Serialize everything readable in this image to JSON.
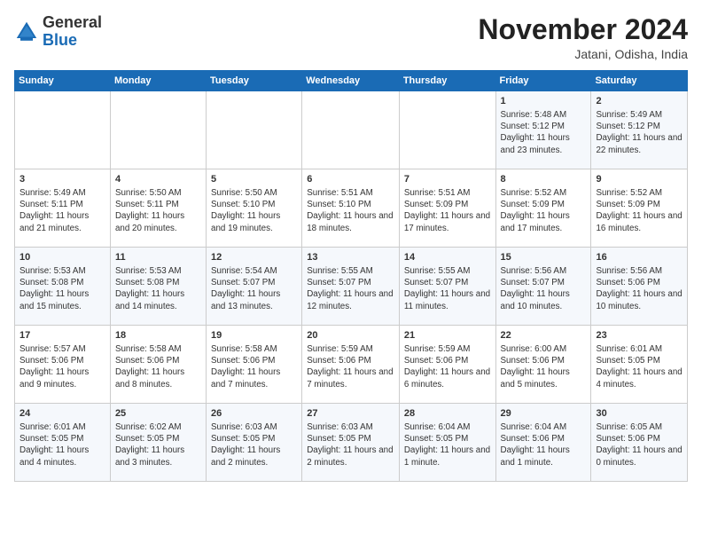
{
  "logo": {
    "general": "General",
    "blue": "Blue"
  },
  "header": {
    "month": "November 2024",
    "location": "Jatani, Odisha, India"
  },
  "weekdays": [
    "Sunday",
    "Monday",
    "Tuesday",
    "Wednesday",
    "Thursday",
    "Friday",
    "Saturday"
  ],
  "weeks": [
    [
      {
        "day": "",
        "info": ""
      },
      {
        "day": "",
        "info": ""
      },
      {
        "day": "",
        "info": ""
      },
      {
        "day": "",
        "info": ""
      },
      {
        "day": "",
        "info": ""
      },
      {
        "day": "1",
        "info": "Sunrise: 5:48 AM\nSunset: 5:12 PM\nDaylight: 11 hours\nand 23 minutes."
      },
      {
        "day": "2",
        "info": "Sunrise: 5:49 AM\nSunset: 5:12 PM\nDaylight: 11 hours\nand 22 minutes."
      }
    ],
    [
      {
        "day": "3",
        "info": "Sunrise: 5:49 AM\nSunset: 5:11 PM\nDaylight: 11 hours\nand 21 minutes."
      },
      {
        "day": "4",
        "info": "Sunrise: 5:50 AM\nSunset: 5:11 PM\nDaylight: 11 hours\nand 20 minutes."
      },
      {
        "day": "5",
        "info": "Sunrise: 5:50 AM\nSunset: 5:10 PM\nDaylight: 11 hours\nand 19 minutes."
      },
      {
        "day": "6",
        "info": "Sunrise: 5:51 AM\nSunset: 5:10 PM\nDaylight: 11 hours\nand 18 minutes."
      },
      {
        "day": "7",
        "info": "Sunrise: 5:51 AM\nSunset: 5:09 PM\nDaylight: 11 hours\nand 17 minutes."
      },
      {
        "day": "8",
        "info": "Sunrise: 5:52 AM\nSunset: 5:09 PM\nDaylight: 11 hours\nand 17 minutes."
      },
      {
        "day": "9",
        "info": "Sunrise: 5:52 AM\nSunset: 5:09 PM\nDaylight: 11 hours\nand 16 minutes."
      }
    ],
    [
      {
        "day": "10",
        "info": "Sunrise: 5:53 AM\nSunset: 5:08 PM\nDaylight: 11 hours\nand 15 minutes."
      },
      {
        "day": "11",
        "info": "Sunrise: 5:53 AM\nSunset: 5:08 PM\nDaylight: 11 hours\nand 14 minutes."
      },
      {
        "day": "12",
        "info": "Sunrise: 5:54 AM\nSunset: 5:07 PM\nDaylight: 11 hours\nand 13 minutes."
      },
      {
        "day": "13",
        "info": "Sunrise: 5:55 AM\nSunset: 5:07 PM\nDaylight: 11 hours\nand 12 minutes."
      },
      {
        "day": "14",
        "info": "Sunrise: 5:55 AM\nSunset: 5:07 PM\nDaylight: 11 hours\nand 11 minutes."
      },
      {
        "day": "15",
        "info": "Sunrise: 5:56 AM\nSunset: 5:07 PM\nDaylight: 11 hours\nand 10 minutes."
      },
      {
        "day": "16",
        "info": "Sunrise: 5:56 AM\nSunset: 5:06 PM\nDaylight: 11 hours\nand 10 minutes."
      }
    ],
    [
      {
        "day": "17",
        "info": "Sunrise: 5:57 AM\nSunset: 5:06 PM\nDaylight: 11 hours\nand 9 minutes."
      },
      {
        "day": "18",
        "info": "Sunrise: 5:58 AM\nSunset: 5:06 PM\nDaylight: 11 hours\nand 8 minutes."
      },
      {
        "day": "19",
        "info": "Sunrise: 5:58 AM\nSunset: 5:06 PM\nDaylight: 11 hours\nand 7 minutes."
      },
      {
        "day": "20",
        "info": "Sunrise: 5:59 AM\nSunset: 5:06 PM\nDaylight: 11 hours\nand 7 minutes."
      },
      {
        "day": "21",
        "info": "Sunrise: 5:59 AM\nSunset: 5:06 PM\nDaylight: 11 hours\nand 6 minutes."
      },
      {
        "day": "22",
        "info": "Sunrise: 6:00 AM\nSunset: 5:06 PM\nDaylight: 11 hours\nand 5 minutes."
      },
      {
        "day": "23",
        "info": "Sunrise: 6:01 AM\nSunset: 5:05 PM\nDaylight: 11 hours\nand 4 minutes."
      }
    ],
    [
      {
        "day": "24",
        "info": "Sunrise: 6:01 AM\nSunset: 5:05 PM\nDaylight: 11 hours\nand 4 minutes."
      },
      {
        "day": "25",
        "info": "Sunrise: 6:02 AM\nSunset: 5:05 PM\nDaylight: 11 hours\nand 3 minutes."
      },
      {
        "day": "26",
        "info": "Sunrise: 6:03 AM\nSunset: 5:05 PM\nDaylight: 11 hours\nand 2 minutes."
      },
      {
        "day": "27",
        "info": "Sunrise: 6:03 AM\nSunset: 5:05 PM\nDaylight: 11 hours\nand 2 minutes."
      },
      {
        "day": "28",
        "info": "Sunrise: 6:04 AM\nSunset: 5:05 PM\nDaylight: 11 hours\nand 1 minute."
      },
      {
        "day": "29",
        "info": "Sunrise: 6:04 AM\nSunset: 5:06 PM\nDaylight: 11 hours\nand 1 minute."
      },
      {
        "day": "30",
        "info": "Sunrise: 6:05 AM\nSunset: 5:06 PM\nDaylight: 11 hours\nand 0 minutes."
      }
    ]
  ]
}
